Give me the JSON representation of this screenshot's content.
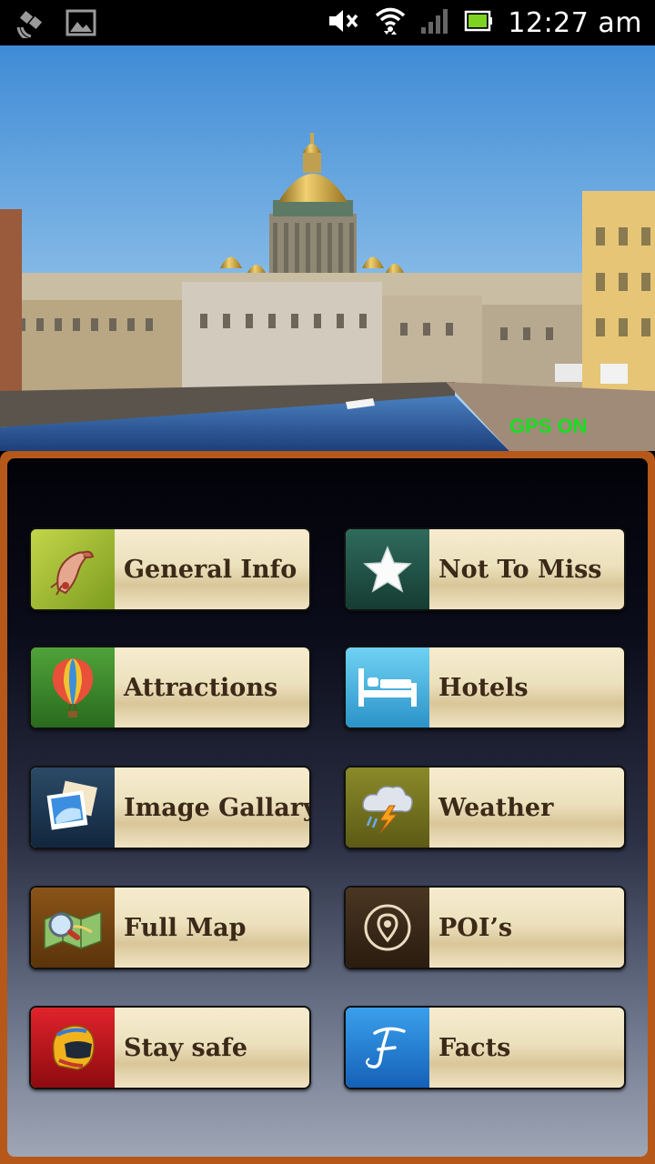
{
  "status_bar": {
    "time": "12:27 am",
    "icons": [
      "satellite-icon",
      "image-icon",
      "mute-icon",
      "wifi-icon",
      "signal-icon",
      "battery-icon"
    ]
  },
  "hero": {
    "gps_status": "GPS ON"
  },
  "menu": {
    "general_info": "General Info",
    "not_to_miss": "Not To Miss",
    "attractions": "Attractions",
    "hotels": "Hotels",
    "image_gallary": "Image Gallary",
    "weather": "Weather",
    "full_map": "Full Map",
    "pois": "POI’s",
    "stay_safe": "Stay safe",
    "facts": "Facts"
  },
  "colors": {
    "panel_border": "#b5581a",
    "gps_text": "#14e01e",
    "button_text": "#3b2a18"
  }
}
